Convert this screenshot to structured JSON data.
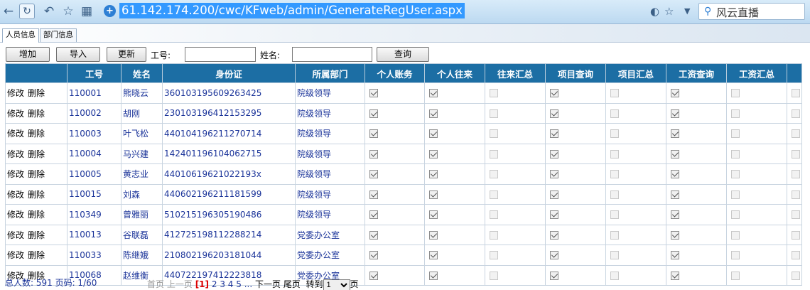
{
  "browser": {
    "url": "61.142.174.200/cwc/KFweb/admin/GenerateRegUser.aspx",
    "search_text": "风云直播"
  },
  "tabs": [
    {
      "label": "人员信息",
      "active": true
    },
    {
      "label": "部门信息",
      "active": false
    }
  ],
  "toolbar": {
    "add_label": "增加",
    "import_label": "导入",
    "update_label": "更新",
    "empno_label": "工号:",
    "empno_value": "",
    "name_label": "姓名:",
    "name_value": "",
    "query_label": "查询"
  },
  "table": {
    "columns": [
      "",
      "工号",
      "姓名",
      "身份证",
      "所属部门",
      "个人账务",
      "个人往来",
      "往来汇总",
      "项目查询",
      "项目汇总",
      "工资查询",
      "工资汇总",
      ""
    ],
    "action_edit": "修改",
    "action_delete": "删除",
    "rows": [
      {
        "id": "110001",
        "name": "熊晓云",
        "idcard": "360103195609263425",
        "dept": "院级领导",
        "perms": [
          true,
          true,
          false,
          true,
          false,
          true,
          false,
          false
        ]
      },
      {
        "id": "110002",
        "name": "胡刚",
        "idcard": "230103196412153295",
        "dept": "院级领导",
        "perms": [
          true,
          true,
          false,
          true,
          false,
          true,
          false,
          false
        ]
      },
      {
        "id": "110003",
        "name": "叶飞松",
        "idcard": "440104196211270714",
        "dept": "院级领导",
        "perms": [
          true,
          true,
          false,
          true,
          false,
          true,
          false,
          false
        ]
      },
      {
        "id": "110004",
        "name": "马兴建",
        "idcard": "142401196104062715",
        "dept": "院级领导",
        "perms": [
          true,
          true,
          false,
          true,
          false,
          true,
          false,
          false
        ]
      },
      {
        "id": "110005",
        "name": "黄志业",
        "idcard": "44010619621022193x",
        "dept": "院级领导",
        "perms": [
          true,
          true,
          false,
          true,
          false,
          true,
          false,
          false
        ]
      },
      {
        "id": "110015",
        "name": "刘森",
        "idcard": "440602196211181599",
        "dept": "院级领导",
        "perms": [
          true,
          true,
          false,
          true,
          false,
          true,
          false,
          false
        ]
      },
      {
        "id": "110349",
        "name": "曾雅丽",
        "idcard": "510215196305190486",
        "dept": "院级领导",
        "perms": [
          true,
          true,
          false,
          true,
          false,
          true,
          false,
          false
        ]
      },
      {
        "id": "110013",
        "name": "谷联磊",
        "idcard": "412725198112288214",
        "dept": "党委办公室",
        "perms": [
          true,
          true,
          false,
          true,
          false,
          true,
          false,
          false
        ]
      },
      {
        "id": "110033",
        "name": "陈继娥",
        "idcard": "210802196203181044",
        "dept": "党委办公室",
        "perms": [
          true,
          true,
          false,
          true,
          false,
          true,
          false,
          false
        ]
      },
      {
        "id": "110068",
        "name": "赵维衡",
        "idcard": "440722197412223818",
        "dept": "党委办公室",
        "perms": [
          true,
          true,
          false,
          true,
          false,
          true,
          false,
          false
        ]
      }
    ]
  },
  "footer": {
    "total": "总人数: 591 页码: 1/60",
    "first": "首页",
    "prev": "上一页",
    "current": "[1]",
    "pages": [
      "2",
      "3",
      "4",
      "5"
    ],
    "ellipsis": "...",
    "next": "下一页",
    "last": "尾页",
    "goto_label": "转到",
    "goto_value": "1",
    "page_suffix": "页"
  }
}
